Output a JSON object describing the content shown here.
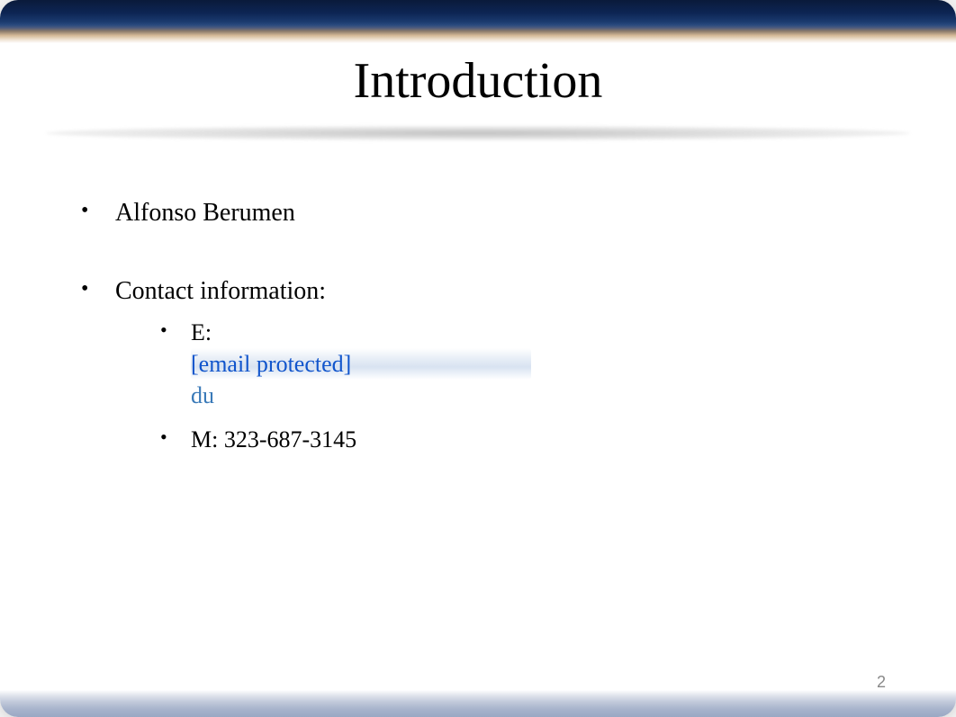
{
  "slide": {
    "title": "Introduction",
    "bullets": [
      {
        "text": "Alfonso Berumen"
      },
      {
        "text": "Contact information:",
        "sub": [
          {
            "label": "E:",
            "email_protected": "[email protected]",
            "email_suffix": "du"
          },
          {
            "text": "M: 323-687-3145"
          }
        ]
      }
    ],
    "page_number": "2"
  }
}
